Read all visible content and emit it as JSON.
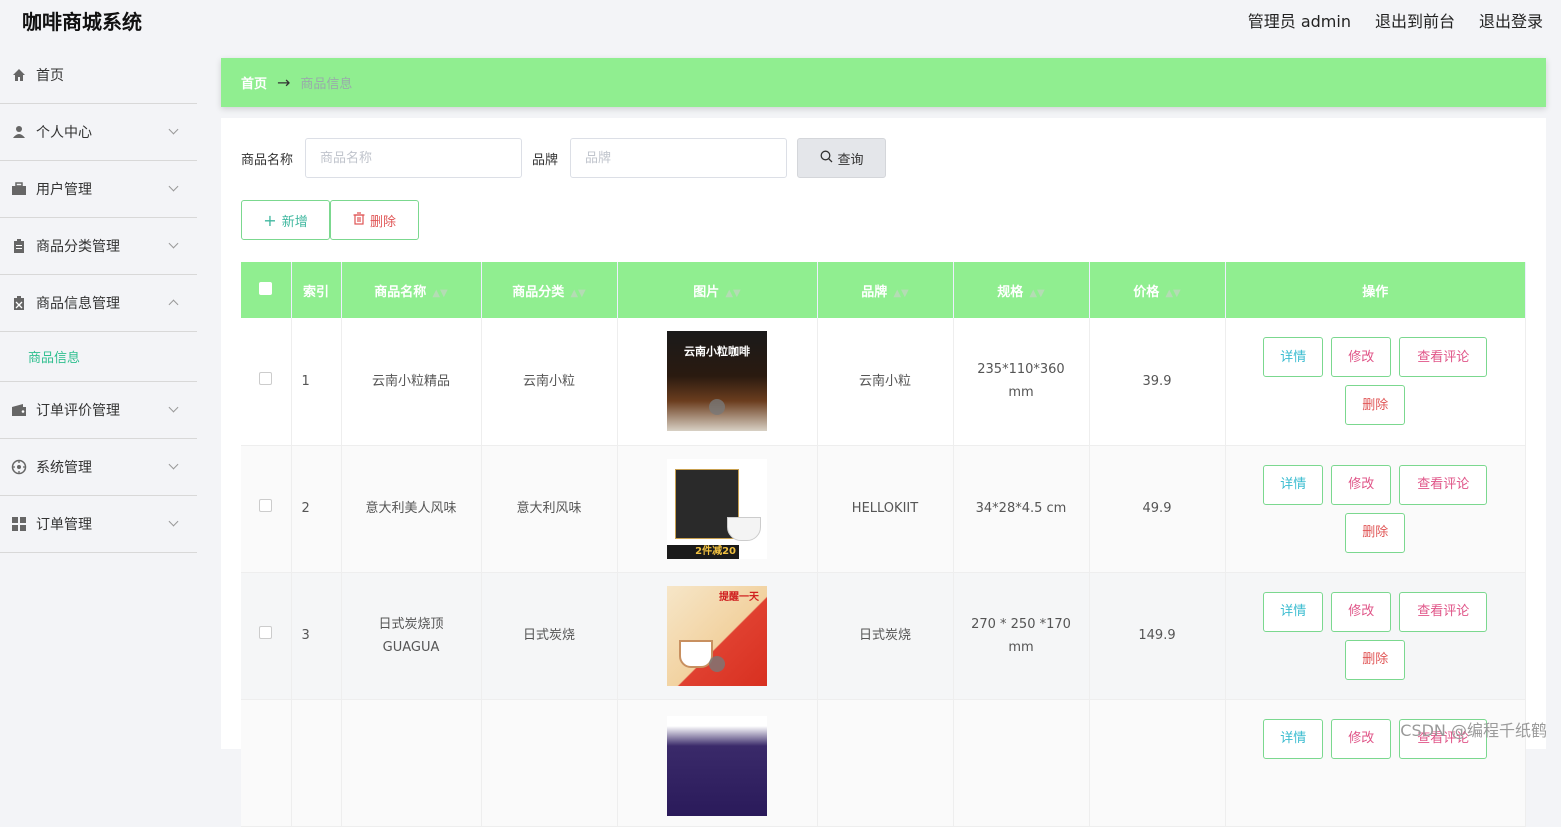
{
  "app": {
    "title": "咖啡商城系统"
  },
  "top_links": {
    "admin": "管理员 admin",
    "front": "退出到前台",
    "logout": "退出登录"
  },
  "sidebar": {
    "items": [
      {
        "label": "首页",
        "icon": "home-icon"
      },
      {
        "label": "个人中心",
        "icon": "user-icon"
      },
      {
        "label": "用户管理",
        "icon": "briefcase-icon"
      },
      {
        "label": "商品分类管理",
        "icon": "clipboard-icon"
      },
      {
        "label": "商品信息管理",
        "icon": "box-icon"
      },
      {
        "label": "订单评价管理",
        "icon": "wallet-icon"
      },
      {
        "label": "系统管理",
        "icon": "compass-icon"
      },
      {
        "label": "订单管理",
        "icon": "grid-icon"
      }
    ],
    "sub_item": "商品信息"
  },
  "breadcrumb": {
    "home": "首页",
    "arrow": "→",
    "current": "商品信息"
  },
  "search": {
    "name_label": "商品名称",
    "name_placeholder": "商品名称",
    "brand_label": "品牌",
    "brand_placeholder": "品牌",
    "query_label": "查询"
  },
  "actions": {
    "add": "新增",
    "delete": "删除"
  },
  "table": {
    "headers": {
      "index": "索引",
      "name": "商品名称",
      "category": "商品分类",
      "image": "图片",
      "brand": "品牌",
      "spec": "规格",
      "price": "价格",
      "ops": "操作"
    },
    "ops": {
      "detail": "详情",
      "edit": "修改",
      "review": "查看评论",
      "delete": "删除"
    },
    "rows": [
      {
        "index": "1",
        "name": "云南小粒精品",
        "category": "云南小粒",
        "brand": "云南小粒",
        "spec": "235*110*360 mm",
        "price": "39.9",
        "image_caption": "云南小粒咖啡"
      },
      {
        "index": "2",
        "name": "意大利美人风味",
        "category": "意大利风味",
        "brand": "HELLOKIIT",
        "spec": "34*28*4.5 cm",
        "price": "49.9",
        "image_caption": "2件减20"
      },
      {
        "index": "3",
        "name": "日式炭烧顶GUAGUA",
        "category": "日式炭烧",
        "brand": "日式炭烧",
        "spec": "270 * 250 *170 mm",
        "price": "149.9",
        "image_caption": "提醒一天"
      },
      {
        "index": "",
        "name": "",
        "category": "",
        "brand": "",
        "spec": "",
        "price": "",
        "image_caption": ""
      }
    ]
  },
  "watermark": "CSDN @编程千纸鹤",
  "colors": {
    "accent": "#90ee90",
    "teal": "#2fbf8f"
  }
}
